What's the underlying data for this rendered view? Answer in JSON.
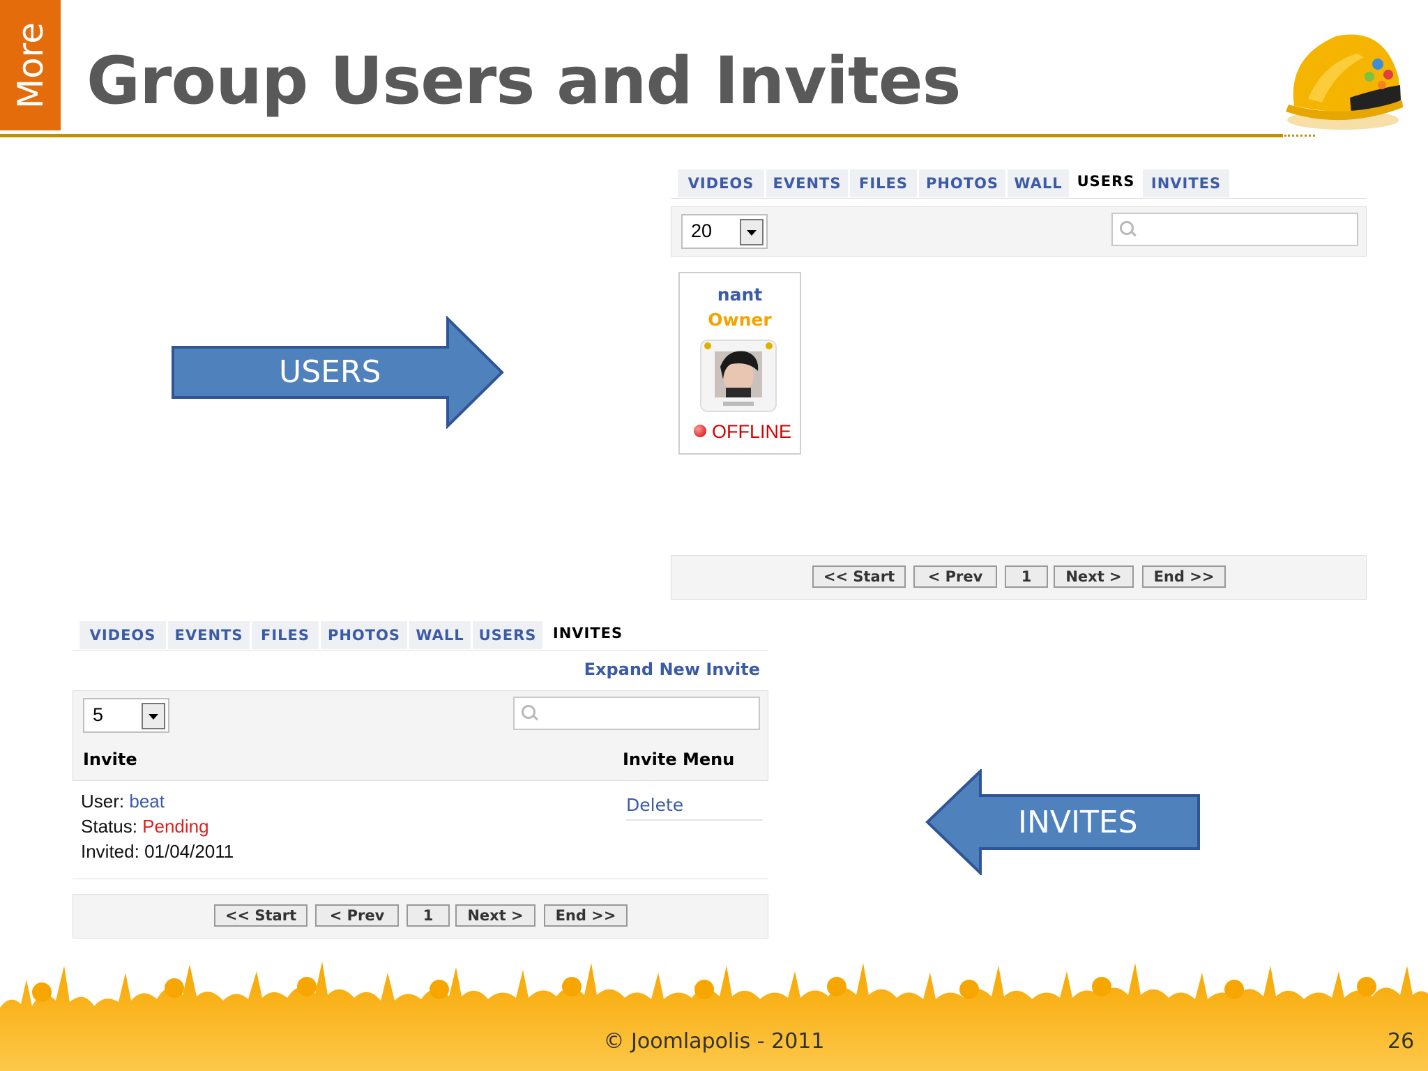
{
  "side_tab": {
    "label": "More"
  },
  "slide_title": "Group Users and Invites",
  "colors": {
    "accent_orange": "#E46C0A",
    "rule_gold": "#BF9000",
    "arrow_blue": "#4F81BD",
    "link_blue": "#3B5AA8",
    "crowd_yellow": "#FBB91A"
  },
  "arrows": {
    "users_label": "USERS",
    "invites_label": "INVITES"
  },
  "users_panel": {
    "tabs": [
      "VIDEOS",
      "EVENTS",
      "FILES",
      "PHOTOS",
      "WALL",
      "USERS",
      "INVITES"
    ],
    "active_tab": "USERS",
    "page_size": "20",
    "search_placeholder": "",
    "card": {
      "name": "nant",
      "role": "Owner",
      "avatar_icon": "user-avatar-icon",
      "status": "OFFLINE"
    },
    "pagination": {
      "start": "<< Start",
      "prev": "< Prev",
      "page": "1",
      "next": "Next >",
      "end": "End >>"
    }
  },
  "invites_panel": {
    "tabs": [
      "VIDEOS",
      "EVENTS",
      "FILES",
      "PHOTOS",
      "WALL",
      "USERS",
      "INVITES"
    ],
    "active_tab": "INVITES",
    "expand_link": "Expand New Invite",
    "page_size": "5",
    "search_placeholder": "",
    "columns": {
      "invite": "Invite",
      "menu": "Invite Menu"
    },
    "row": {
      "user_label": "User:",
      "user_value": "beat",
      "status_label": "Status:",
      "status_value": "Pending",
      "invited_label": "Invited:",
      "invited_value": "01/04/2011",
      "action": "Delete"
    },
    "pagination": {
      "start": "<< Start",
      "prev": "< Prev",
      "page": "1",
      "next": "Next >",
      "end": "End >>"
    }
  },
  "footer": {
    "copyright": "© Joomlapolis - 2011",
    "slide_number": "26"
  }
}
